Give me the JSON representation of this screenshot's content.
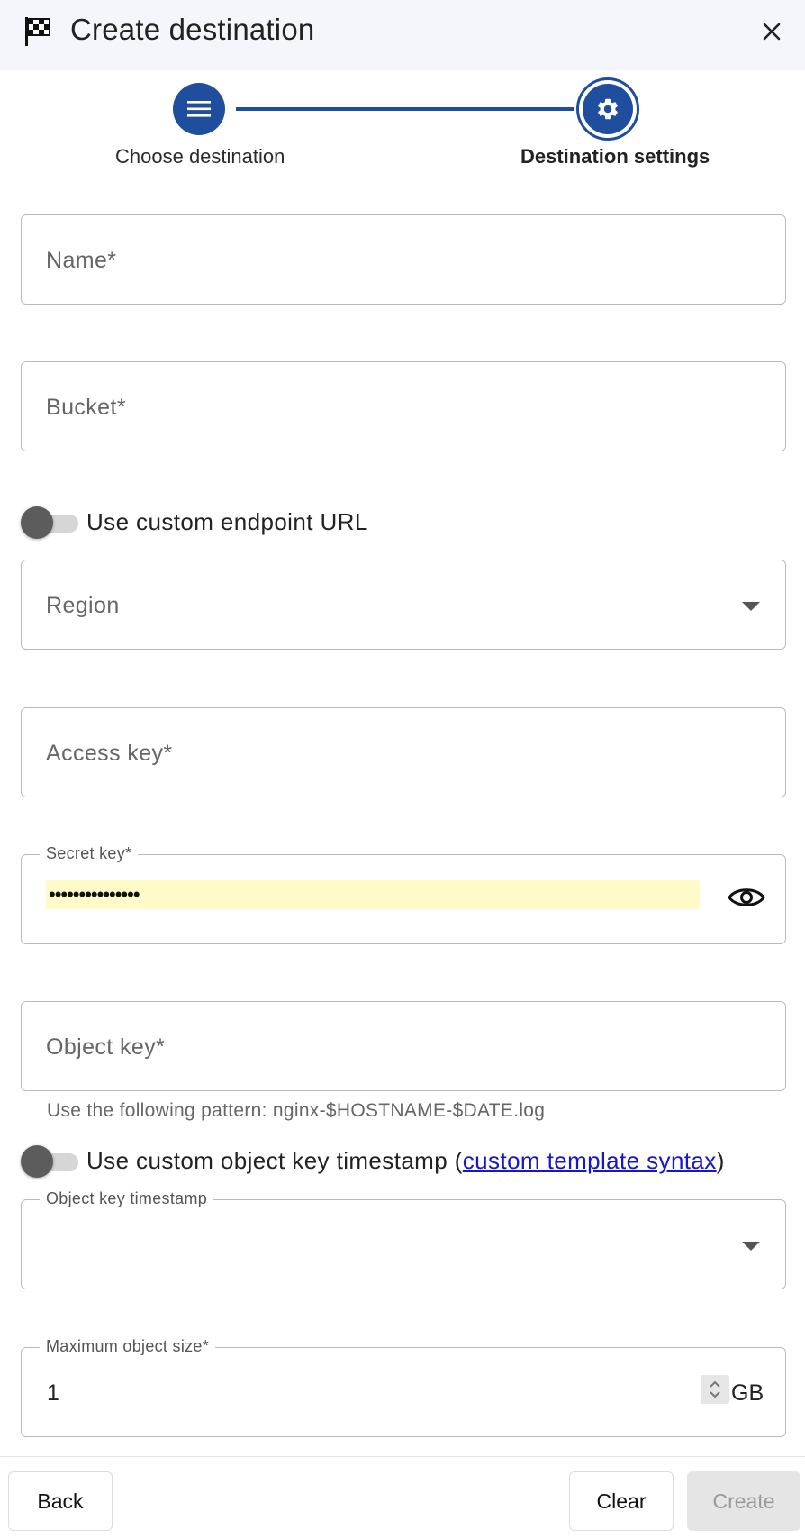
{
  "header": {
    "title": "Create destination"
  },
  "stepper": {
    "steps": [
      {
        "label": "Choose destination",
        "icon": "list-icon"
      },
      {
        "label": "Destination settings",
        "icon": "gear-icon"
      }
    ]
  },
  "form": {
    "name": {
      "placeholder": "Name*"
    },
    "bucket": {
      "placeholder": "Bucket*"
    },
    "custom_endpoint": {
      "label": "Use custom endpoint URL",
      "checked": false
    },
    "region": {
      "placeholder": "Region"
    },
    "access_key": {
      "placeholder": "Access key*"
    },
    "secret_key": {
      "label": "Secret key*",
      "value": "•••••••••••••••"
    },
    "object_key": {
      "placeholder": "Object key*",
      "helper": "Use the following pattern: nginx-$HOSTNAME-$DATE.log"
    },
    "custom_timestamp": {
      "label_prefix": "Use custom object key timestamp (",
      "link": "custom template syntax",
      "label_suffix": ")",
      "checked": false
    },
    "object_key_timestamp": {
      "label": "Object key timestamp",
      "value": ""
    },
    "max_object_size": {
      "label": "Maximum object size*",
      "value": "1",
      "unit": "GB"
    }
  },
  "footer": {
    "back": "Back",
    "clear": "Clear",
    "create": "Create"
  },
  "colors": {
    "primary": "#1f4e9e",
    "link": "#1616cc",
    "autofill": "#fffbc9"
  }
}
